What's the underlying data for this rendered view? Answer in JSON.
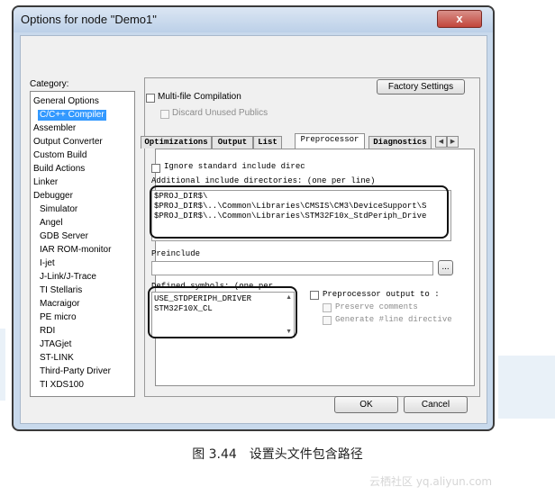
{
  "dialog": {
    "title": "Options for node \"Demo1\"",
    "close_glyph": "x",
    "category_label": "Category:",
    "categories": [
      {
        "label": "General Options",
        "sub": false,
        "selected": false
      },
      {
        "label": "C/C++ Compiler",
        "sub": true,
        "selected": true
      },
      {
        "label": "Assembler",
        "sub": false,
        "selected": false
      },
      {
        "label": "Output Converter",
        "sub": false,
        "selected": false
      },
      {
        "label": "Custom Build",
        "sub": false,
        "selected": false
      },
      {
        "label": "Build Actions",
        "sub": false,
        "selected": false
      },
      {
        "label": "Linker",
        "sub": false,
        "selected": false
      },
      {
        "label": "Debugger",
        "sub": false,
        "selected": false
      },
      {
        "label": "Simulator",
        "sub": true,
        "selected": false
      },
      {
        "label": "Angel",
        "sub": true,
        "selected": false
      },
      {
        "label": "GDB Server",
        "sub": true,
        "selected": false
      },
      {
        "label": "IAR ROM-monitor",
        "sub": true,
        "selected": false
      },
      {
        "label": "I-jet",
        "sub": true,
        "selected": false
      },
      {
        "label": "J-Link/J-Trace",
        "sub": true,
        "selected": false
      },
      {
        "label": "TI Stellaris",
        "sub": true,
        "selected": false
      },
      {
        "label": "Macraigor",
        "sub": true,
        "selected": false
      },
      {
        "label": "PE micro",
        "sub": true,
        "selected": false
      },
      {
        "label": "RDI",
        "sub": true,
        "selected": false
      },
      {
        "label": "JTAGjet",
        "sub": true,
        "selected": false
      },
      {
        "label": "ST-LINK",
        "sub": true,
        "selected": false
      },
      {
        "label": "Third-Party Driver",
        "sub": true,
        "selected": false
      },
      {
        "label": "TI XDS100",
        "sub": true,
        "selected": false
      }
    ],
    "factory_settings_label": "Factory Settings",
    "multifile_label": "Multi-file Compilation",
    "discard_label": "Discard Unused Publics",
    "tabs": [
      "Optimizations",
      "Output",
      "List",
      "Preprocessor",
      "Diagnostics"
    ],
    "active_tab": "Preprocessor",
    "ignore_label": "Ignore standard include direc",
    "include_label": "Additional include directories: (one per line)",
    "include_lines": [
      "$PROJ_DIR$\\",
      "$PROJ_DIR$\\..\\Common\\Libraries\\CMSIS\\CM3\\DeviceSupport\\S",
      "$PROJ_DIR$\\..\\Common\\Libraries\\STM32F10x_StdPeriph_Drive"
    ],
    "preinclude_label": "Preinclude",
    "preinclude_value": "",
    "browse_label": "...",
    "defined_label": "Defined symbols: (one per",
    "defined_lines": [
      "USE_STDPERIPH_DRIVER",
      "STM32F10X_CL"
    ],
    "preproc_output_label": "Preprocessor output to :",
    "preserve_label": "Preserve comments",
    "generate_label": "Generate #line directive",
    "ok_label": "OK",
    "cancel_label": "Cancel"
  },
  "caption": "图 3.44　设置头文件包含路径",
  "watermark": "云栖社区 yq.aliyun.com",
  "colors": {
    "selection": "#3399ff",
    "titlebar": "#c8d9ec",
    "close": "#c2463b"
  }
}
